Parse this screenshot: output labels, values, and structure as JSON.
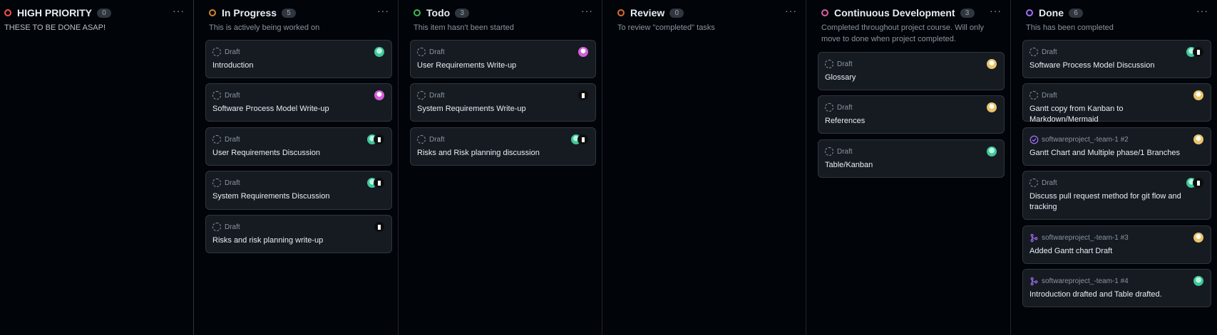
{
  "colors": {
    "high_priority": "#f85149",
    "in_progress": "#d1852e",
    "todo": "#3fb950",
    "review": "#db6d28",
    "continuous": "#db61a2",
    "done": "#a371f7"
  },
  "columns": [
    {
      "title": "HIGH PRIORITY",
      "count": "0",
      "status_color": "#f85149",
      "description": "THESE TO BE DONE ASAP!",
      "cards": []
    },
    {
      "title": "In Progress",
      "count": "5",
      "status_color": "#d1852e",
      "description": "This is actively being worked on",
      "cards": [
        {
          "meta": "Draft",
          "meta_icon": "draft-icon",
          "title": "Introduction",
          "avatars": [
            "green"
          ]
        },
        {
          "meta": "Draft",
          "meta_icon": "draft-icon",
          "title": "Software Process Model Write-up",
          "avatars": [
            "pink"
          ]
        },
        {
          "meta": "Draft",
          "meta_icon": "draft-icon",
          "title": "User Requirements Discussion",
          "avatars": [
            "green",
            "dark"
          ]
        },
        {
          "meta": "Draft",
          "meta_icon": "draft-icon",
          "title": "System Requirements Discussion",
          "avatars": [
            "green",
            "dark"
          ]
        },
        {
          "meta": "Draft",
          "meta_icon": "draft-icon",
          "title": "Risks and risk planning write-up",
          "avatars": [
            "dark"
          ]
        }
      ]
    },
    {
      "title": "Todo",
      "count": "3",
      "status_color": "#3fb950",
      "description": "This item hasn't been started",
      "cards": [
        {
          "meta": "Draft",
          "meta_icon": "draft-icon",
          "title": "User Requirements Write-up",
          "avatars": [
            "pink"
          ]
        },
        {
          "meta": "Draft",
          "meta_icon": "draft-icon",
          "title": "System Requirements Write-up",
          "avatars": [
            "dark"
          ]
        },
        {
          "meta": "Draft",
          "meta_icon": "draft-icon",
          "title": "Risks and Risk planning discussion",
          "avatars": [
            "green",
            "dark"
          ]
        }
      ]
    },
    {
      "title": "Review",
      "count": "0",
      "status_color": "#db6d28",
      "description": "To review \"completed\" tasks",
      "cards": []
    },
    {
      "title": "Continuous Development",
      "count": "3",
      "status_color": "#db61a2",
      "description": "Completed throughout project course. Will only move to done when project completed.",
      "cards": [
        {
          "meta": "Draft",
          "meta_icon": "draft-icon",
          "title": "Glossary",
          "avatars": [
            "yellow"
          ]
        },
        {
          "meta": "Draft",
          "meta_icon": "draft-icon",
          "title": "References",
          "avatars": [
            "yellow"
          ]
        },
        {
          "meta": "Draft",
          "meta_icon": "draft-icon",
          "title": "Table/Kanban",
          "avatars": [
            "green"
          ]
        }
      ]
    },
    {
      "title": "Done",
      "count": "6",
      "status_color": "#a371f7",
      "description": "This has been completed",
      "cards": [
        {
          "meta": "Draft",
          "meta_icon": "draft-icon",
          "title": "Software Process Model Discussion",
          "avatars": [
            "green",
            "dark"
          ]
        },
        {
          "meta": "Draft",
          "meta_icon": "draft-icon",
          "title": "Gantt copy from Kanban to Markdown/Mermaid",
          "avatars": [
            "yellow"
          ]
        },
        {
          "meta": "softwareproject_-team-1 #2",
          "meta_icon": "issue-closed-icon",
          "title": "Gantt Chart and Multiple phase/1 Branches",
          "avatars": [
            "yellow"
          ]
        },
        {
          "meta": "Draft",
          "meta_icon": "draft-icon",
          "title": "Discuss pull request method for git flow and tracking",
          "avatars": [
            "green",
            "dark"
          ]
        },
        {
          "meta": "softwareproject_-team-1 #3",
          "meta_icon": "pull-request-merged-icon",
          "title": "Added Gantt chart Draft",
          "avatars": [
            "yellow"
          ]
        },
        {
          "meta": "softwareproject_-team-1 #4",
          "meta_icon": "pull-request-merged-icon",
          "title": "Introduction drafted and Table drafted.",
          "avatars": [
            "green"
          ]
        }
      ]
    }
  ],
  "menu_label": "···"
}
